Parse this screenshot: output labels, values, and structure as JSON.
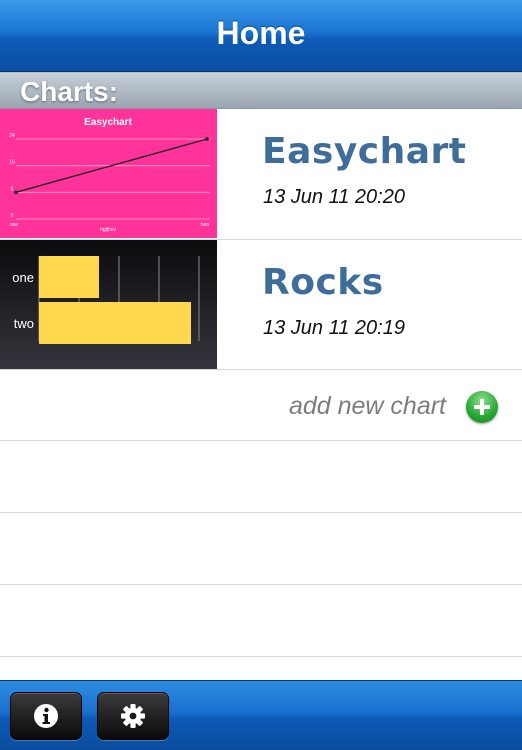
{
  "navbar": {
    "title": "Home"
  },
  "section": {
    "title": "Charts:"
  },
  "charts": [
    {
      "name": "Easychart",
      "date": "13 Jun 11 20:20",
      "thumbnail": {
        "bg_color": "#ff3399",
        "chart_data": {
          "type": "line",
          "title": "Easychart",
          "categories": [
            "one",
            "two"
          ],
          "y_ticks": [
            "0",
            "8",
            "16",
            "24"
          ],
          "xlabel": "hgfjhvv",
          "ylim": [
            0,
            24
          ],
          "series": [
            {
              "values": [
                8,
                24
              ]
            }
          ]
        }
      }
    },
    {
      "name": "Rocks",
      "date": "13 Jun 11 20:19",
      "thumbnail": {
        "bg_color": "#1d1d22",
        "bar_color": "#ffd84d",
        "chart_data": {
          "type": "bar",
          "orientation": "horizontal",
          "categories": [
            "one",
            "two"
          ],
          "xlim": [
            0,
            4
          ],
          "series": [
            {
              "values": [
                1.5,
                3.8
              ]
            }
          ]
        }
      }
    }
  ],
  "add_row": {
    "label": "add new chart",
    "icon": "plus-circle-icon"
  },
  "toolbar": {
    "buttons": [
      {
        "name": "info-button",
        "icon": "info-icon"
      },
      {
        "name": "settings-button",
        "icon": "gear-icon"
      }
    ]
  },
  "colors": {
    "navbar_blue": "#1a74d3",
    "chart_name_blue": "#3d6d98",
    "add_green": "#27a532"
  }
}
